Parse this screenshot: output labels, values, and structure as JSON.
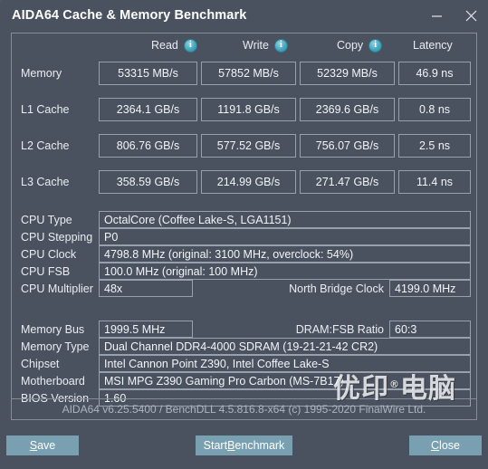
{
  "window": {
    "title": "AIDA64 Cache & Memory Benchmark",
    "controls": [
      {
        "name": "minimize-button",
        "glyph": "–"
      },
      {
        "name": "close-button",
        "glyph": "×"
      }
    ]
  },
  "benchmark": {
    "columns": [
      {
        "label": "Read",
        "info": true,
        "info_glyph": "i"
      },
      {
        "label": "Write",
        "info": true,
        "info_glyph": "i"
      },
      {
        "label": "Copy",
        "info": true,
        "info_glyph": "i"
      },
      {
        "label": "Latency",
        "info": false,
        "info_glyph": ""
      }
    ],
    "rows": [
      {
        "label": "Memory",
        "read": "53315 MB/s",
        "write": "57852 MB/s",
        "copy": "52329 MB/s",
        "latency": "46.9 ns"
      },
      {
        "label": "L1 Cache",
        "read": "2364.1 GB/s",
        "write": "1191.8 GB/s",
        "copy": "2369.6 GB/s",
        "latency": "0.8 ns"
      },
      {
        "label": "L2 Cache",
        "read": "806.76 GB/s",
        "write": "577.52 GB/s",
        "copy": "756.07 GB/s",
        "latency": "2.5 ns"
      },
      {
        "label": "L3 Cache",
        "read": "358.59 GB/s",
        "write": "214.99 GB/s",
        "copy": "271.47 GB/s",
        "latency": "11.4 ns"
      }
    ]
  },
  "cpu_info": {
    "cpu_type_label": "CPU Type",
    "cpu_type_value": "OctalCore   (Coffee Lake-S, LGA1151)",
    "cpu_stepping_label": "CPU Stepping",
    "cpu_stepping_value": "P0",
    "cpu_clock_label": "CPU Clock",
    "cpu_clock_value": "4798.8 MHz  (original: 3100 MHz, overclock: 54%)",
    "cpu_fsb_label": "CPU FSB",
    "cpu_fsb_value": "100.0 MHz  (original: 100 MHz)",
    "cpu_multiplier_label": "CPU Multiplier",
    "cpu_multiplier_value": "48x",
    "north_bridge_clock_label": "North Bridge Clock",
    "north_bridge_clock_value": "4199.0 MHz"
  },
  "memory_info": {
    "memory_bus_label": "Memory Bus",
    "memory_bus_value": "1999.5 MHz",
    "dram_fsb_ratio_label": "DRAM:FSB Ratio",
    "dram_fsb_ratio_value": "60:3",
    "memory_type_label": "Memory Type",
    "memory_type_value": "Dual Channel DDR4-4000 SDRAM  (19-21-21-42 CR2)",
    "chipset_label": "Chipset",
    "chipset_value": "Intel Cannon Point Z390, Intel Coffee Lake-S",
    "motherboard_label": "Motherboard",
    "motherboard_value": "MSI MPG Z390 Gaming Pro Carbon (MS-7B17)",
    "bios_version_label": "BIOS Version",
    "bios_version_value": "1.60"
  },
  "credit": "AIDA64 v6.25.5400 / BenchDLL 4.5.816.8-x64  (c) 1995-2020 FinalWire Ltd.",
  "watermark": {
    "text": "优印",
    "sup": "®",
    "text2": "电脑"
  },
  "buttons": {
    "save": {
      "pre": "",
      "accel": "S",
      "post": "ave"
    },
    "start": {
      "pre": "Start ",
      "accel": "B",
      "post": "enchmark"
    },
    "close": {
      "pre": "",
      "accel": "C",
      "post": "lose"
    }
  },
  "colors": {
    "window_bg": "#4a525f",
    "panel_border": "#868d98",
    "box_border": "#98a0ab",
    "text": "#f2f5f8",
    "accent_button": "#78a0b1",
    "info_icon": "#45a8bf"
  }
}
